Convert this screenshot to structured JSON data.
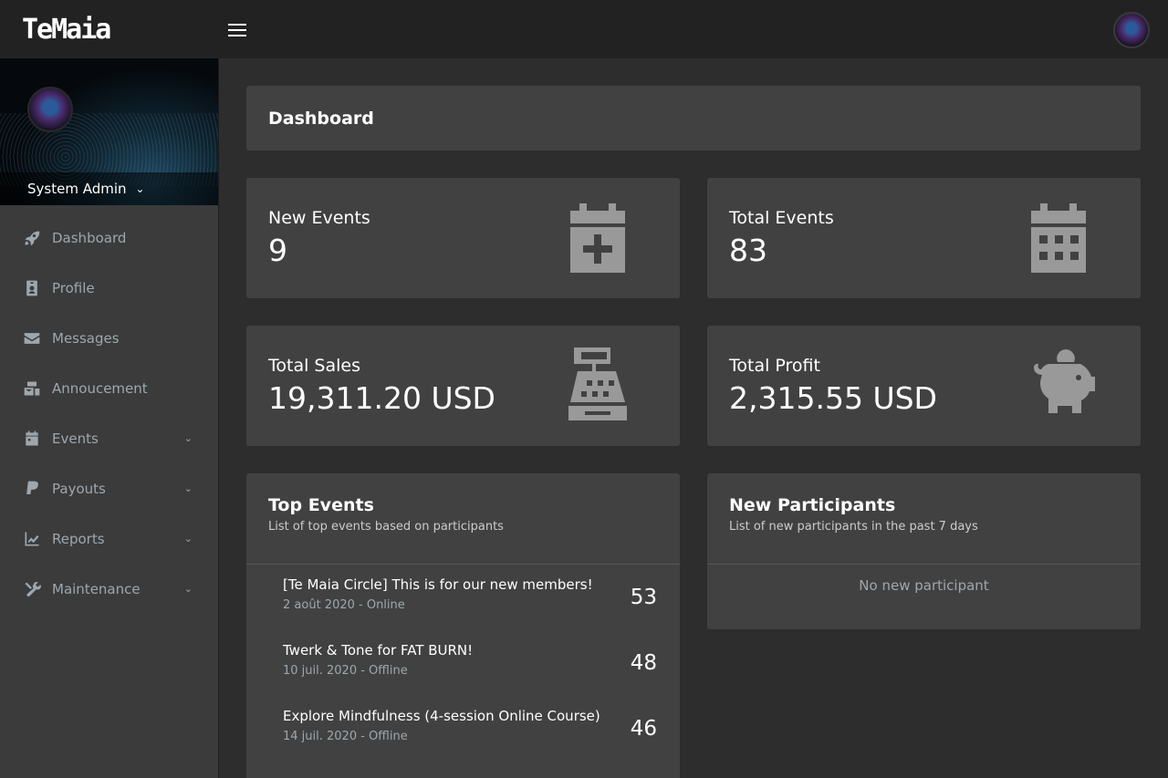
{
  "brand": {
    "logo_text": "TeMaia"
  },
  "user": {
    "name": "System Admin"
  },
  "sidebar": {
    "items": [
      {
        "label": "Dashboard",
        "icon": "rocket-icon",
        "has_submenu": false
      },
      {
        "label": "Profile",
        "icon": "id-badge-icon",
        "has_submenu": false
      },
      {
        "label": "Messages",
        "icon": "envelope-icon",
        "has_submenu": false
      },
      {
        "label": "Annoucement",
        "icon": "mail-bulk-icon",
        "has_submenu": false
      },
      {
        "label": "Events",
        "icon": "calendar-icon",
        "has_submenu": true
      },
      {
        "label": "Payouts",
        "icon": "paypal-icon",
        "has_submenu": true
      },
      {
        "label": "Reports",
        "icon": "chart-line-icon",
        "has_submenu": true
      },
      {
        "label": "Maintenance",
        "icon": "tools-icon",
        "has_submenu": true
      }
    ]
  },
  "header": {
    "title": "Dashboard"
  },
  "stats": [
    {
      "label": "New Events",
      "value": "9",
      "icon": "calendar-plus-icon"
    },
    {
      "label": "Total Events",
      "value": "83",
      "icon": "calendar-icon"
    },
    {
      "label": "Total Sales",
      "value": "19,311.20 USD",
      "icon": "cash-register-icon"
    },
    {
      "label": "Total Profit",
      "value": "2,315.55 USD",
      "icon": "piggy-bank-icon"
    }
  ],
  "top_events": {
    "title": "Top Events",
    "subtitle": "List of top events based on participants",
    "rows": [
      {
        "name": "[Te Maia Circle] This is for our new members!",
        "meta": "2 août 2020 - Online",
        "count": "53"
      },
      {
        "name": "Twerk & Tone for FAT BURN!",
        "meta": "10 juil. 2020 - Offline",
        "count": "48"
      },
      {
        "name": "Explore Mindfulness (4-session Online Course)",
        "meta": "14 juil. 2020 - Offline",
        "count": "46"
      }
    ]
  },
  "new_participants": {
    "title": "New Participants",
    "subtitle": "List of new participants in the past 7 days",
    "empty_text": "No new participant"
  },
  "colors": {
    "background": "#2d2d2d",
    "card": "#414141",
    "sidebar": "#3b3b3b",
    "topbar": "#222222",
    "muted": "#9ea7ad",
    "icon": "#999999"
  }
}
